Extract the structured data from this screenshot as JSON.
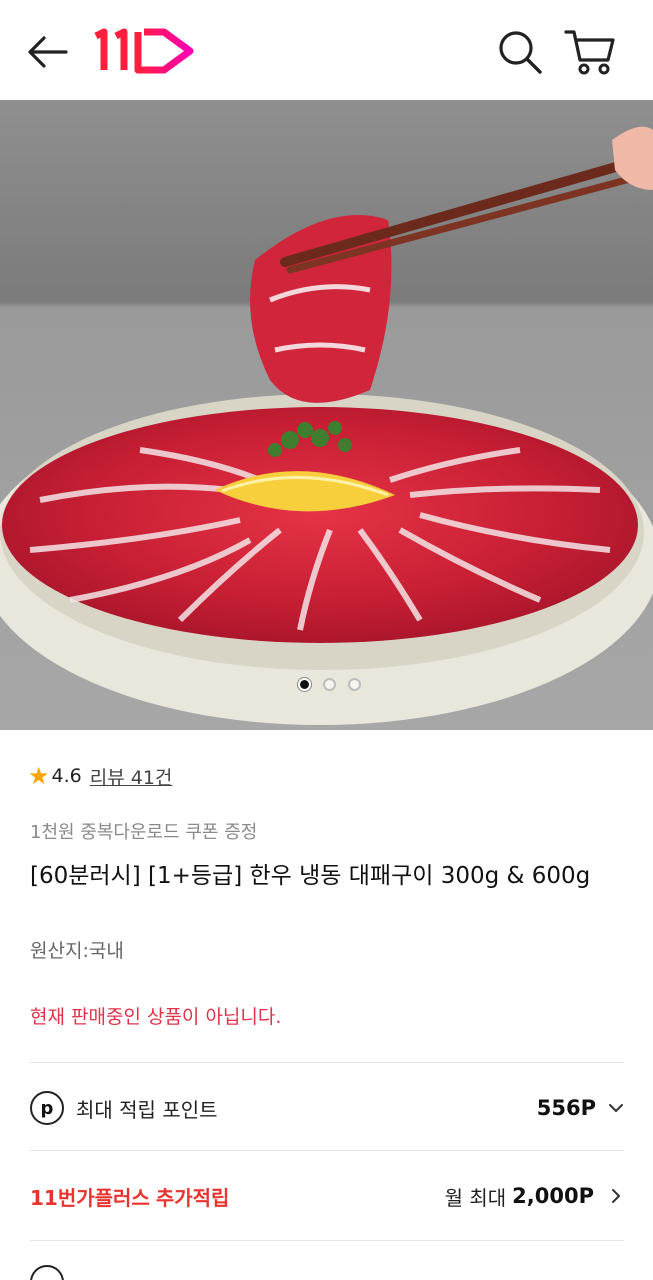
{
  "header": {
    "back_icon": "arrow-left-icon",
    "logo_text": "11",
    "logo_colors": [
      "#ff1f3d",
      "#ff00b4"
    ],
    "search_icon": "search-icon",
    "cart_icon": "cart-icon"
  },
  "carousel": {
    "total": 3,
    "active": 0
  },
  "rating": {
    "value": "4.6",
    "review_link": "리뷰 41건"
  },
  "product": {
    "coupon_note": "1천원 중복다운로드 쿠폰 증정",
    "title": "[60분러시] [1+등급] 한우 냉동 대패구이 300g & 600g",
    "origin": "원산지:국내",
    "status": "현재 판매중인 상품이 아닙니다."
  },
  "points": {
    "icon_letter": "p",
    "label": "최대 적립 포인트",
    "value": "556P"
  },
  "plus": {
    "brand": "11번가플러스",
    "extra": "추가적립",
    "prefix": "월 최대",
    "value": "2,000P"
  },
  "colors": {
    "accent_red": "#e8332e",
    "status_red": "#e0334a",
    "star": "#f7a600"
  }
}
